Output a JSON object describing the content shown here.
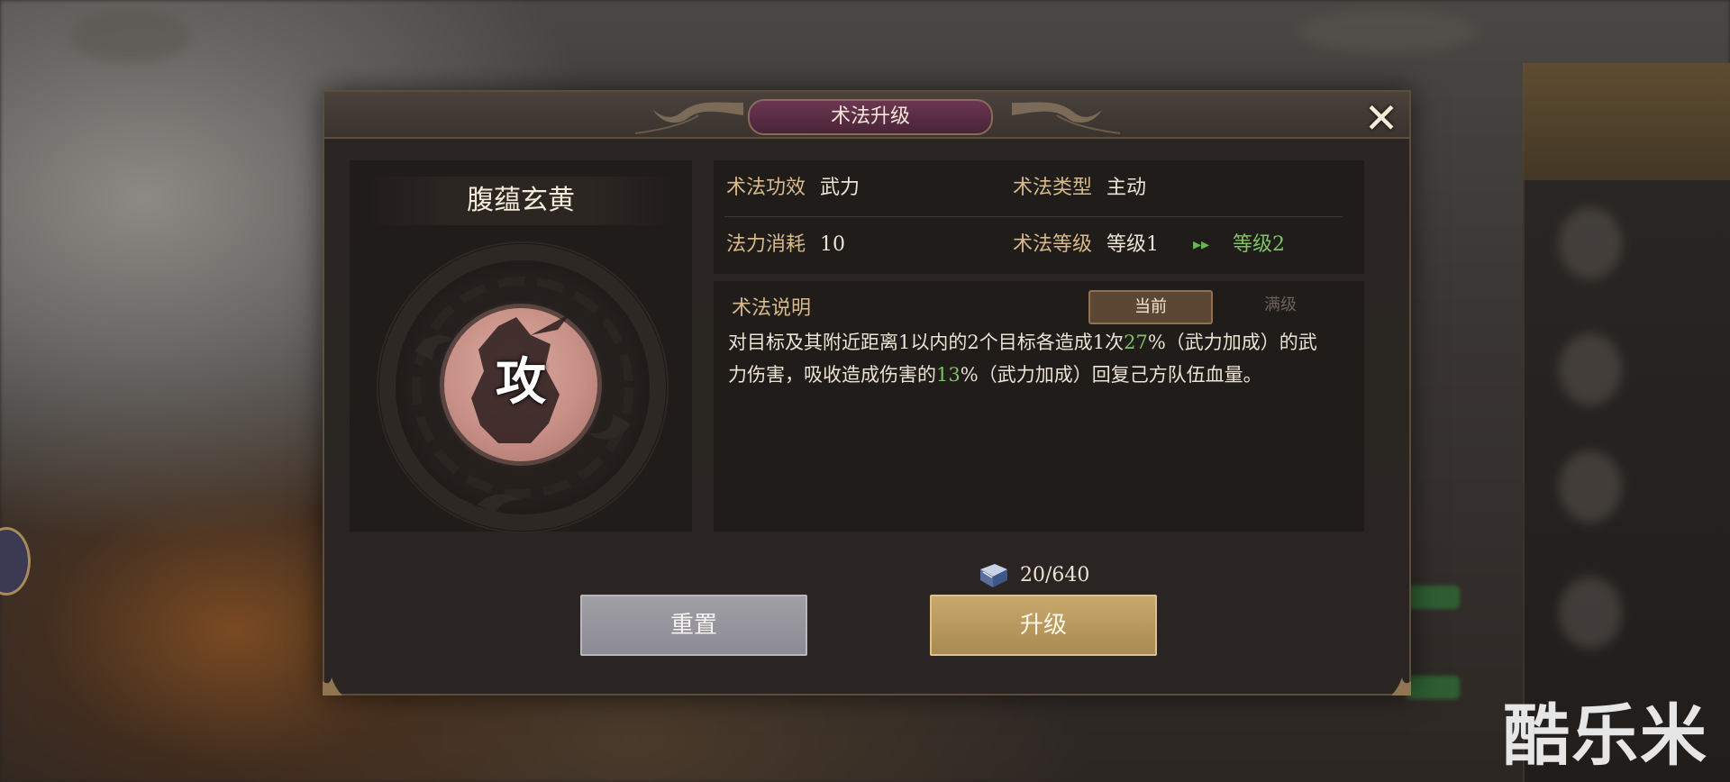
{
  "dialog": {
    "title": "术法升级",
    "close_icon": "close-x-icon"
  },
  "skill": {
    "name": "腹蕴玄黄",
    "emblem_char": "攻"
  },
  "info": {
    "effect_label": "术法功效",
    "effect_value": "武力",
    "type_label": "术法类型",
    "type_value": "主动",
    "cost_label": "法力消耗",
    "cost_value": "10",
    "level_label": "术法等级",
    "level_current": "等级1",
    "level_arrow": "▸▸",
    "level_next": "等级2"
  },
  "description": {
    "title": "术法说明",
    "tab_current": "当前",
    "tab_max": "满级",
    "line1_a": "对目标及其附近距离1以内的2个目标各造成1次",
    "line1_pct": "27",
    "line1_b": "%（武力加成）的武",
    "line2_a": "力伤害，吸收造成伤害的",
    "line2_pct": "13",
    "line2_b": "%（武力加成）回复己方队伍血量。"
  },
  "cost": {
    "icon": "book-icon",
    "text": "20/640"
  },
  "buttons": {
    "reset": "重置",
    "upgrade": "升级"
  },
  "watermark": "酷乐米",
  "colors": {
    "accent_gold": "#d7b98a",
    "highlight_green": "#7fc266",
    "title_plaque": "#6b3650",
    "upgrade_button": "#c8a86c",
    "reset_button": "#a19fa6"
  }
}
